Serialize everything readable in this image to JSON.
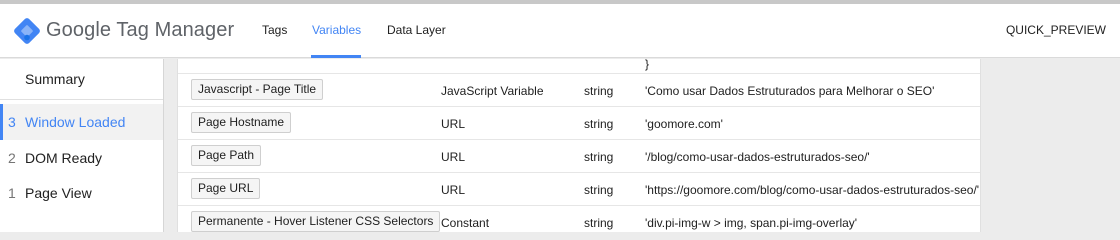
{
  "app": {
    "brand": "Google Tag Manager",
    "colors": {
      "blue": "#4285f4",
      "dark_blue": "#1a73e8",
      "light_blue": "#8ab4f8"
    }
  },
  "nav": {
    "tabs": [
      {
        "label": "Tags"
      },
      {
        "label": "Variables",
        "active": true
      },
      {
        "label": "Data Layer"
      }
    ],
    "quick_preview": "QUICK_PREVIEW"
  },
  "sidebar": {
    "summary": "Summary",
    "events": [
      {
        "num": "3",
        "label": "Window Loaded",
        "active": true
      },
      {
        "num": "2",
        "label": "DOM Ready"
      },
      {
        "num": "1",
        "label": "Page View"
      }
    ]
  },
  "variables": {
    "overflow_text": "}",
    "rows": [
      {
        "name": "Javascript - Page Title",
        "type": "JavaScript Variable",
        "data_type": "string",
        "value": "'Como usar Dados Estruturados para Melhorar o SEO'"
      },
      {
        "name": "Page Hostname",
        "type": "URL",
        "data_type": "string",
        "value": "'goomore.com'"
      },
      {
        "name": "Page Path",
        "type": "URL",
        "data_type": "string",
        "value": "'/blog/como-usar-dados-estruturados-seo/'"
      },
      {
        "name": "Page URL",
        "type": "URL",
        "data_type": "string",
        "value": "'https://goomore.com/blog/como-usar-dados-estruturados-seo/'"
      },
      {
        "name": "Permanente - Hover Listener CSS Selectors",
        "type": "Constant",
        "data_type": "string",
        "value": "'div.pi-img-w > img, span.pi-img-overlay'"
      }
    ]
  }
}
